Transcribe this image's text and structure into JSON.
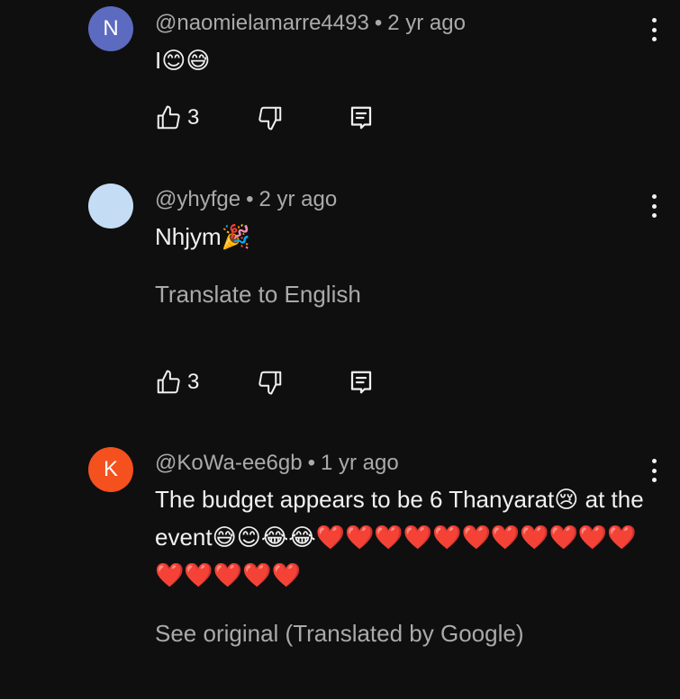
{
  "comments": [
    {
      "avatar_letter": "N",
      "avatar_color": "#5c6bc0",
      "handle": "@naomielamarre4493",
      "separator": "•",
      "age": "2 yr ago",
      "text": "I😊😅",
      "like_count": "3"
    },
    {
      "avatar_letter": "",
      "avatar_color": "#c5dcf5",
      "handle": "@yhyfge",
      "separator": "•",
      "age": "2 yr ago",
      "text": "Nhjym🎉",
      "translate_label": "Translate to English",
      "like_count": "3"
    },
    {
      "avatar_letter": "K",
      "avatar_color": "#f4511e",
      "handle": "@KoWa-ee6gb",
      "separator": "•",
      "age": "1 yr ago",
      "text": "The budget appears to be 6 Thanyarat😢 at the event😅😊😂😂❤️❤️❤️❤️❤️❤️❤️❤️❤️❤️❤️❤️❤️❤️❤️❤️",
      "translated_label": "See original (Translated by Google)"
    }
  ],
  "icons": {
    "like": "thumbs-up-icon",
    "dislike": "thumbs-down-icon",
    "reply": "reply-icon",
    "more": "more-vertical-icon"
  }
}
